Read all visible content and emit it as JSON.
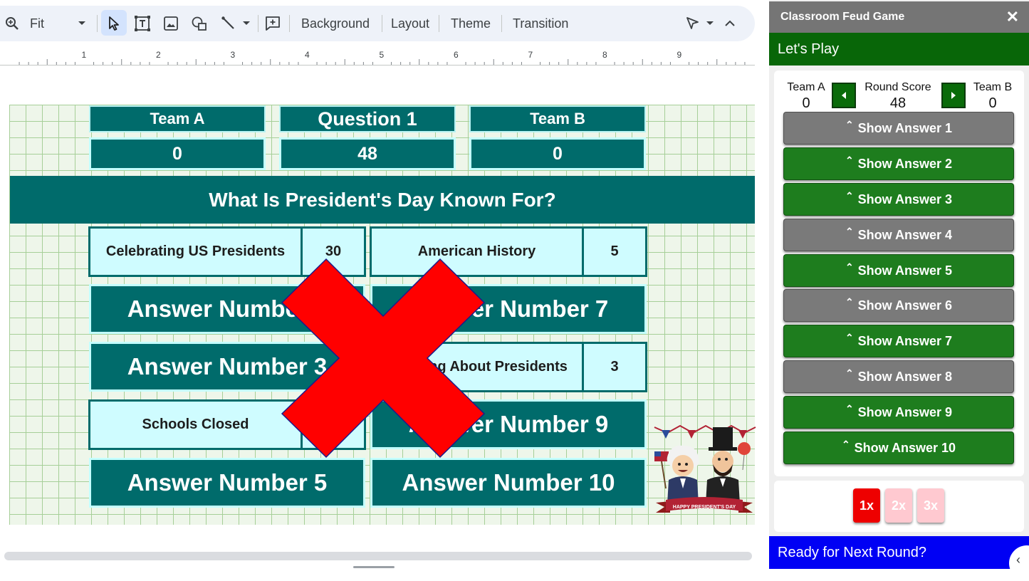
{
  "toolbar": {
    "zoom_label": "Fit",
    "background_label": "Background",
    "layout_label": "Layout",
    "theme_label": "Theme",
    "transition_label": "Transition"
  },
  "ruler": {
    "marks": [
      "1",
      "2",
      "3",
      "4",
      "5",
      "6",
      "7",
      "8",
      "9"
    ]
  },
  "slide": {
    "team_a_label": "Team A",
    "question_label": "Question 1",
    "team_b_label": "Team B",
    "team_a_score": "0",
    "round_score": "48",
    "team_b_score": "0",
    "question": "What Is President's Day Known For?",
    "answers": {
      "a1": {
        "text": "Celebrating US Presidents",
        "points": "30"
      },
      "a2": {
        "text": "Answer Number 2"
      },
      "a3": {
        "text": "Answer Number 3"
      },
      "a4": {
        "text": "Schools Closed"
      },
      "a5": {
        "text": "Answer Number 5"
      },
      "a6": {
        "text": "American History",
        "points": "5"
      },
      "a7": {
        "text": "Answer Number 7"
      },
      "a8": {
        "text": "Learning About Presidents",
        "points": "3"
      },
      "a9": {
        "text": "Answer Number 9"
      },
      "a10": {
        "text": "Answer Number 10"
      }
    },
    "badge_text": "HAPPY PRESIDENT'S DAY",
    "strike_color": "#ff0000"
  },
  "panel": {
    "title": "Classroom Feud Game",
    "section_title": "Let's Play",
    "team_a_label": "Team A",
    "team_a_score": "0",
    "round_score_label": "Round Score",
    "round_score": "48",
    "team_b_label": "Team B",
    "team_b_score": "0",
    "answer_buttons": [
      {
        "label": "Show Answer 1",
        "state": "revealed"
      },
      {
        "label": "Show Answer 2",
        "state": "hidden"
      },
      {
        "label": "Show Answer 3",
        "state": "hidden"
      },
      {
        "label": "Show Answer 4",
        "state": "revealed"
      },
      {
        "label": "Show Answer 5",
        "state": "hidden"
      },
      {
        "label": "Show Answer 6",
        "state": "revealed"
      },
      {
        "label": "Show Answer 7",
        "state": "hidden"
      },
      {
        "label": "Show Answer 8",
        "state": "revealed"
      },
      {
        "label": "Show Answer 9",
        "state": "hidden"
      },
      {
        "label": "Show Answer 10",
        "state": "hidden"
      }
    ],
    "multipliers": [
      "1x",
      "2x",
      "3x"
    ],
    "active_multiplier": "1x",
    "next_round_label": "Ready for Next Round?"
  },
  "colors": {
    "teal": "#006b6b",
    "revealed_cell": "#cffcff",
    "panel_green": "#1e7d1e",
    "panel_gray": "#7a7a7a",
    "next_round_blue": "#0000f4"
  }
}
